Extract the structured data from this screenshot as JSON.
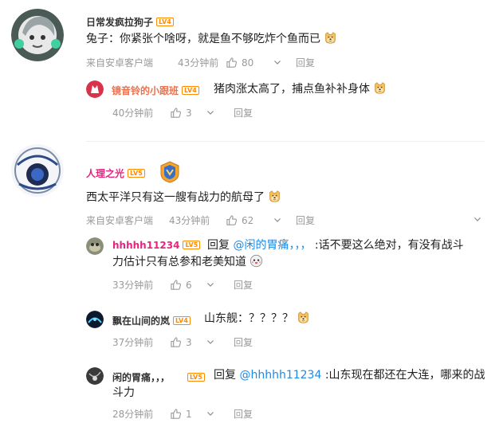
{
  "comments": [
    {
      "username": "日常发疯拉狗子",
      "level": "LV4",
      "text": "兔子：你紧张个啥呀，就是鱼不够吃炸个鱼而已",
      "source": "来自安卓客户端",
      "time": "43分钟前",
      "likes": "80",
      "reply_label": "回复",
      "replies": [
        {
          "username": "镜音铃的小跟班",
          "level": "LV4",
          "text": "猪肉涨太高了，捕点鱼补补身体",
          "time": "40分钟前",
          "likes": "3",
          "reply_label": "回复"
        }
      ]
    },
    {
      "username": "人理之光",
      "level": "LV5",
      "text": "西太平洋只有这一艘有战力的航母了",
      "source": "来自安卓客户端",
      "time": "43分钟前",
      "likes": "62",
      "reply_label": "回复",
      "replies": [
        {
          "username": "hhhhh11234",
          "level": "LV5",
          "reply_prefix": "回复",
          "mention": "@闲的胃痛，，，",
          "text_line1": ":话不要这么绝对，有没有战斗",
          "text_line2": "力估计只有总参和老美知道",
          "time": "33分钟前",
          "likes": "6",
          "reply_label": "回复"
        },
        {
          "username": "飘在山间的岚",
          "level": "LV4",
          "text": "山东舰：？？？？",
          "time": "37分钟前",
          "likes": "3",
          "reply_label": "回复"
        },
        {
          "username": "闲的胃痛，，，",
          "level": "LV5",
          "reply_prefix": "回复",
          "mention": "@hhhhh11234",
          "text_line1": ":山东现在都还在大连，哪来的战",
          "text_line2": "斗力",
          "time": "28分钟前",
          "likes": "1",
          "reply_label": "回复"
        }
      ]
    }
  ],
  "colors": {
    "accent": "#eb7350",
    "mention": "#1e88e5",
    "meta": "#999999",
    "level": "#ff8a00"
  },
  "icons": [
    "thumbs-up-icon",
    "caret-down-icon",
    "doge-emoji",
    "medal-badge-icon",
    "face-emoji"
  ]
}
